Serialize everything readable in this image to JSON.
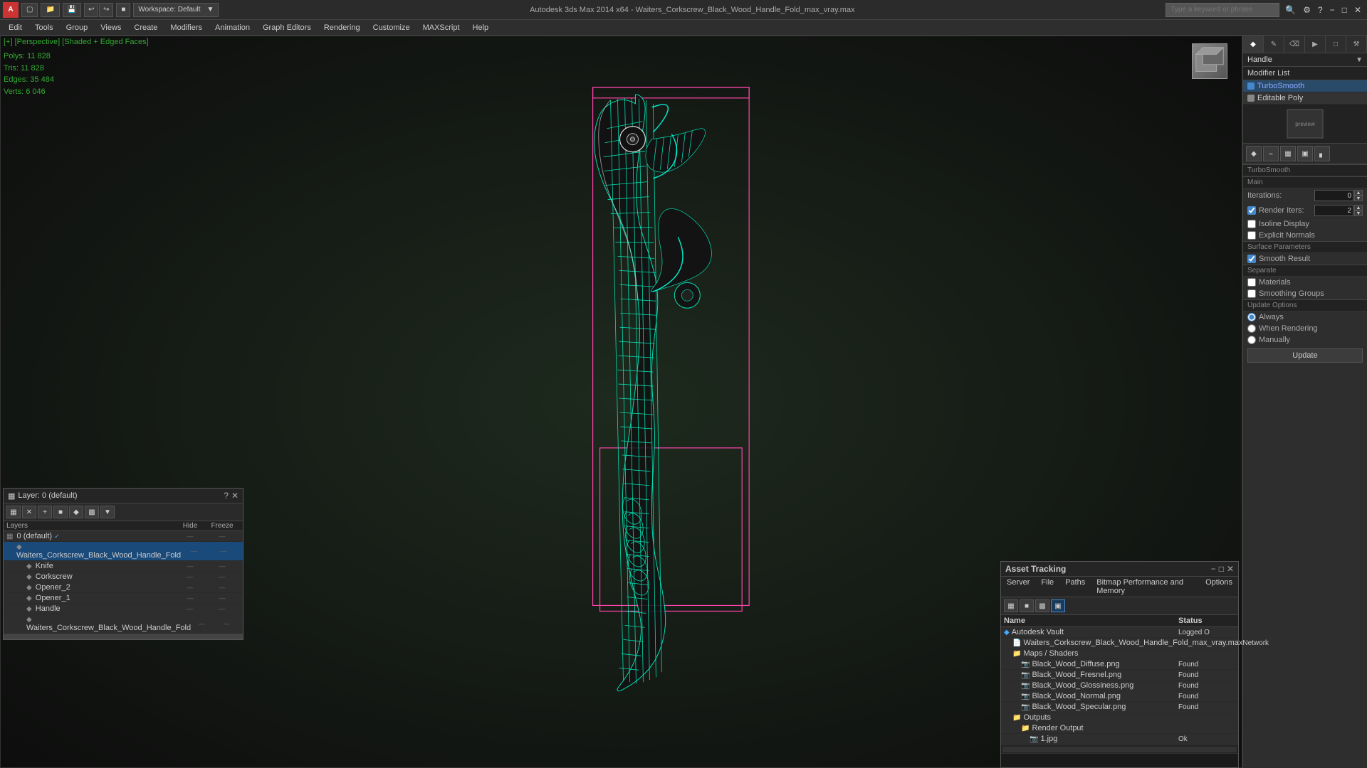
{
  "window": {
    "title": "Autodesk 3ds Max 2014 x64 - Waiters_Corkscrew_Black_Wood_Handle_Fold_max_vray.max",
    "workspace_label": "Workspace: Default"
  },
  "menubar": {
    "items": [
      "Edit",
      "Tools",
      "Group",
      "Views",
      "Create",
      "Modifiers",
      "Animation",
      "Graph Editors",
      "Rendering",
      "Customize",
      "MAXScript",
      "Help"
    ]
  },
  "viewport": {
    "label": "[+] [Perspective] [Shaded + Edged Faces]",
    "stats": {
      "polys_label": "Polys:",
      "polys_value": "11 828",
      "tris_label": "Tris:",
      "tris_value": "11 828",
      "edges_label": "Edges:",
      "edges_value": "35 484",
      "verts_label": "Verts:",
      "verts_value": "6 046"
    }
  },
  "right_panel": {
    "handle_label": "Handle",
    "modifier_list_label": "Modifier List",
    "turbosmooth_label": "TurboSmooth",
    "editable_poly_label": "Editable Poly",
    "turbosmooth_section": "TurboSmooth",
    "main_section": "Main",
    "iterations_label": "Iterations:",
    "iterations_value": "0",
    "render_iters_label": "Render Iters:",
    "render_iters_value": "2",
    "isoline_display_label": "Isoline Display",
    "explicit_normals_label": "Explicit Normals",
    "surface_params_label": "Surface Parameters",
    "smooth_result_label": "Smooth Result",
    "separate_label": "Separate",
    "materials_label": "Materials",
    "smoothing_groups_label": "Smoothing Groups",
    "update_options_label": "Update Options",
    "always_label": "Always",
    "when_rendering_label": "When Rendering",
    "manually_label": "Manually",
    "update_btn_label": "Update"
  },
  "layer_panel": {
    "title": "Layer: 0 (default)",
    "col_layers": "Layers",
    "col_hide": "Hide",
    "col_freeze": "Freeze",
    "layers": [
      {
        "id": "0",
        "name": "0 (default)",
        "indent": 0,
        "active": true,
        "type": "layer"
      },
      {
        "id": "1",
        "name": "Waiters_Corkscrew_Black_Wood_Handle_Fold",
        "indent": 1,
        "selected": true,
        "type": "object"
      },
      {
        "id": "2",
        "name": "Knife",
        "indent": 2,
        "type": "object"
      },
      {
        "id": "3",
        "name": "Corkscrew",
        "indent": 2,
        "type": "object"
      },
      {
        "id": "4",
        "name": "Opener_2",
        "indent": 2,
        "type": "object"
      },
      {
        "id": "5",
        "name": "Opener_1",
        "indent": 2,
        "type": "object"
      },
      {
        "id": "6",
        "name": "Handle",
        "indent": 2,
        "type": "object"
      },
      {
        "id": "7",
        "name": "Waiters_Corkscrew_Black_Wood_Handle_Fold",
        "indent": 2,
        "type": "object"
      }
    ]
  },
  "asset_panel": {
    "title": "Asset Tracking",
    "menu_items": [
      "Server",
      "File",
      "Paths",
      "Bitmap Performance and Memory",
      "Options"
    ],
    "col_name": "Name",
    "col_status": "Status",
    "assets": [
      {
        "id": "vault",
        "name": "Autodesk Vault",
        "indent": 0,
        "type": "vault",
        "status": "Logged O"
      },
      {
        "id": "maxfile",
        "name": "Waiters_Corkscrew_Black_Wood_Handle_Fold_max_vray.max",
        "indent": 1,
        "type": "file",
        "status": "Network"
      },
      {
        "id": "maps",
        "name": "Maps / Shaders",
        "indent": 1,
        "type": "folder",
        "status": ""
      },
      {
        "id": "diff",
        "name": "Black_Wood_Diffuse.png",
        "indent": 2,
        "type": "image",
        "status": "Found"
      },
      {
        "id": "fresnel",
        "name": "Black_Wood_Fresnel.png",
        "indent": 2,
        "type": "image",
        "status": "Found"
      },
      {
        "id": "gloss",
        "name": "Black_Wood_Glossiness.png",
        "indent": 2,
        "type": "image",
        "status": "Found"
      },
      {
        "id": "normal",
        "name": "Black_Wood_Normal.png",
        "indent": 2,
        "type": "image",
        "status": "Found"
      },
      {
        "id": "spec",
        "name": "Black_Wood_Specular.png",
        "indent": 2,
        "type": "image",
        "status": "Found"
      },
      {
        "id": "outputs",
        "name": "Outputs",
        "indent": 1,
        "type": "folder",
        "status": ""
      },
      {
        "id": "render",
        "name": "Render Output",
        "indent": 2,
        "type": "folder",
        "status": ""
      },
      {
        "id": "jpg",
        "name": "1.jpg",
        "indent": 3,
        "type": "image",
        "status": "Ok"
      }
    ]
  },
  "search": {
    "placeholder": "Type a keyword or phrase"
  }
}
